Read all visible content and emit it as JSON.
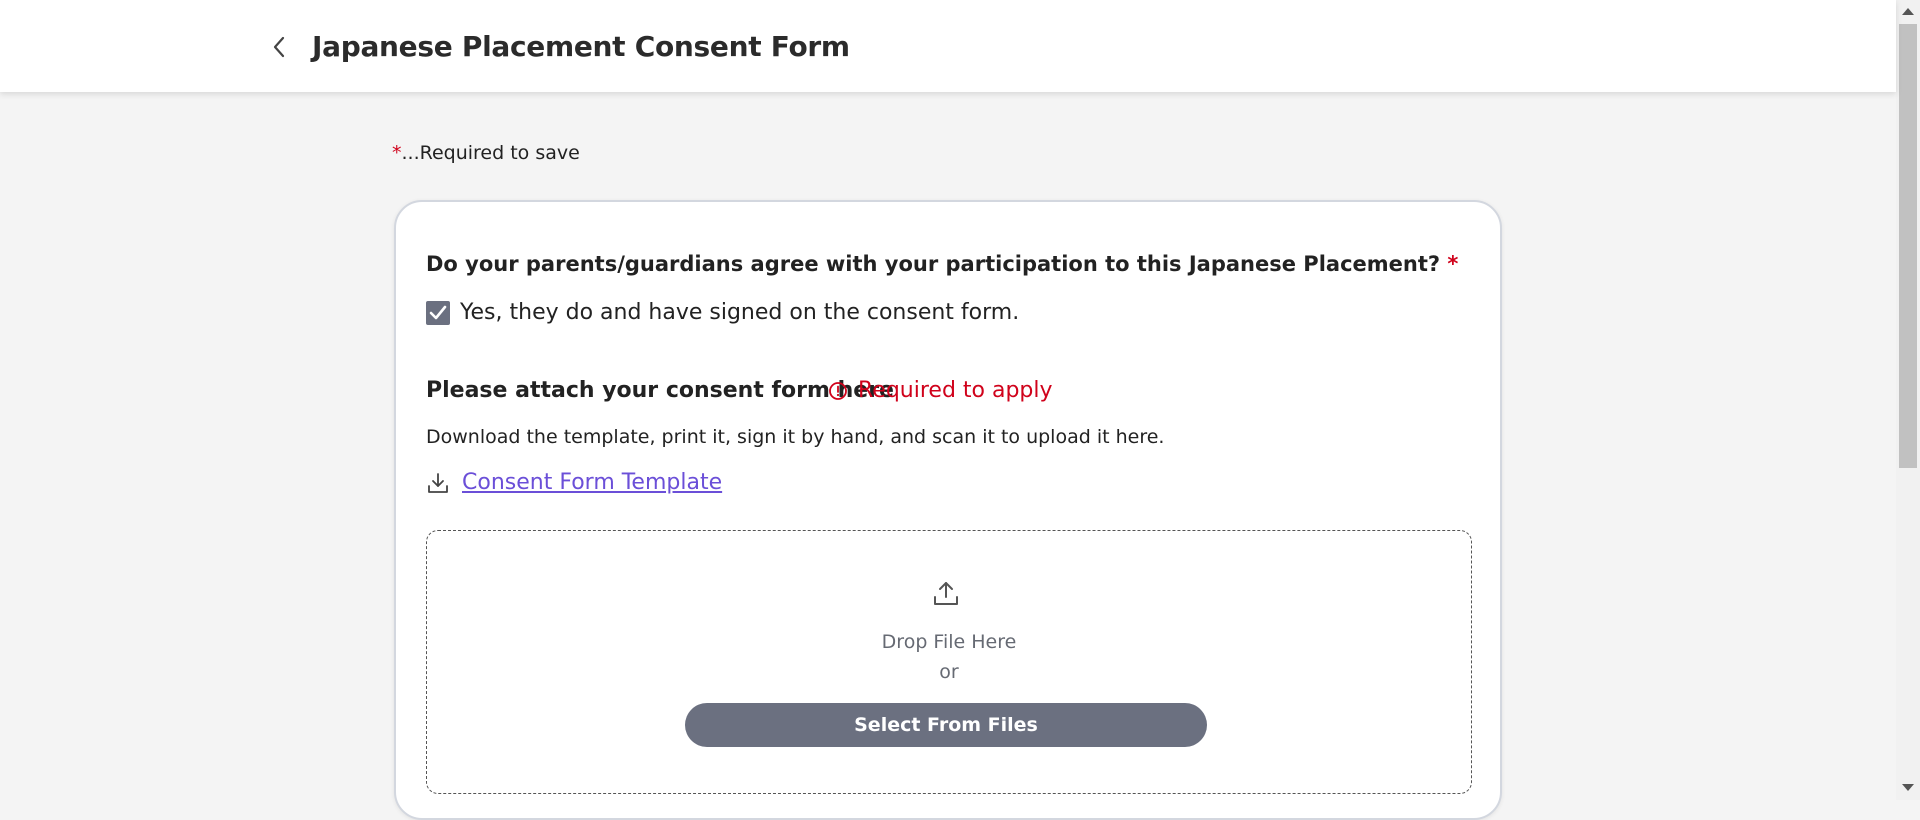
{
  "header": {
    "title": "Japanese Placement Consent Form",
    "back_icon": "chevron-left-icon"
  },
  "required_note": {
    "star": "*",
    "text": "...Required to save"
  },
  "form": {
    "question": "Do your parents/guardians agree with your participation to this Japanese Placement?",
    "question_star": "*",
    "checkbox": {
      "label": "Yes, they do and have signed on the consent form.",
      "checked": true
    },
    "attach": {
      "title": "Please attach your consent form here",
      "required_text": "Required to apply",
      "instructions": "Download the template, print it, sign it by hand, and scan it to upload it here.",
      "template_link": "Consent Form Template"
    },
    "dropzone": {
      "drop_text": "Drop File Here",
      "or_text": "or",
      "button_label": "Select From Files"
    }
  },
  "colors": {
    "required_red": "#d0021b",
    "link_purple": "#6b4fd8",
    "button_gray": "#6b7080"
  }
}
